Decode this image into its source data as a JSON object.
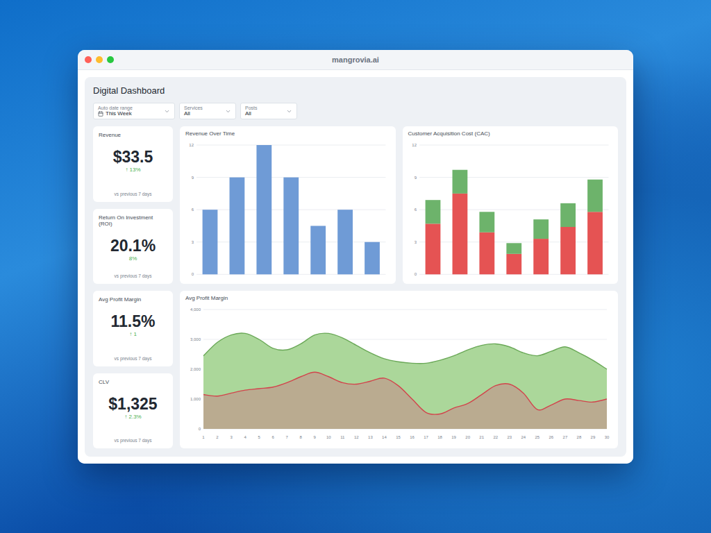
{
  "window": {
    "title": "mangrovia.ai"
  },
  "dashboard": {
    "title": "Digital Dashboard"
  },
  "filters": [
    {
      "label": "Auto date range",
      "value": "This Week",
      "kind": "date"
    },
    {
      "label": "Services",
      "value": "All",
      "kind": "select"
    },
    {
      "label": "Posts",
      "value": "All",
      "kind": "select"
    }
  ],
  "kpis": [
    {
      "label": "Revenue",
      "value": "$33.5",
      "change": "↑ 13%",
      "note": "vs previous 7 days"
    },
    {
      "label": "Return On Investment (ROI)",
      "value": "20.1%",
      "change": "8%",
      "note": "vs previous 7 days"
    },
    {
      "label": "Avg Profit Margin",
      "value": "11.5%",
      "change": "↑ 1",
      "note": "vs previous 7 days"
    },
    {
      "label": "CLV",
      "value": "$1,325",
      "change": "↑ 2.3%",
      "note": "vs previous 7 days"
    }
  ],
  "revenue_chart": {
    "title": "Revenue Over Time",
    "ticks": [
      "0",
      "3",
      "6",
      "9",
      "12"
    ],
    "series": [
      {
        "color": "#6f9bd6",
        "values": [
          6,
          9,
          12,
          9,
          4.5,
          6,
          3
        ]
      }
    ]
  },
  "cac_chart": {
    "title": "Customer Acquisition Cost (CAC)",
    "ticks": [
      "0",
      "3",
      "6",
      "9",
      "12"
    ],
    "series": [
      {
        "color": "#e55353",
        "values": [
          4.7,
          7.5,
          3.9,
          1.9,
          3.3,
          4.4,
          5.8
        ]
      },
      {
        "color": "#6db36b",
        "values": [
          2.2,
          2.2,
          1.9,
          1.0,
          1.8,
          2.2,
          3.0
        ]
      }
    ]
  },
  "margin_chart": {
    "title": "Avg Profit Margin",
    "ticks": [
      "0",
      "1,000",
      "2,000",
      "3,000",
      "4,000"
    ],
    "x_labels": [
      "1",
      "2",
      "3",
      "4",
      "5",
      "6",
      "7",
      "8",
      "9",
      "10",
      "11",
      "12",
      "13",
      "14",
      "15",
      "16",
      "17",
      "18",
      "19",
      "20",
      "21",
      "22",
      "23",
      "24",
      "25",
      "26",
      "27",
      "28",
      "29",
      "30"
    ],
    "series": [
      {
        "color": "#6aa857",
        "values": [
          2450,
          2900,
          3150,
          3200,
          3000,
          2700,
          2650,
          2850,
          3150,
          3200,
          3050,
          2800,
          2550,
          2350,
          2250,
          2200,
          2200,
          2300,
          2450,
          2650,
          2800,
          2850,
          2750,
          2550,
          2450,
          2600,
          2750,
          2550,
          2300,
          2000
        ]
      },
      {
        "color": "#d2434b",
        "values": [
          1150,
          1100,
          1200,
          1300,
          1350,
          1400,
          1550,
          1750,
          1900,
          1750,
          1550,
          1500,
          1600,
          1700,
          1450,
          1000,
          550,
          500,
          700,
          850,
          1150,
          1450,
          1500,
          1200,
          650,
          800,
          1000,
          950,
          900,
          1000
        ]
      }
    ]
  }
}
